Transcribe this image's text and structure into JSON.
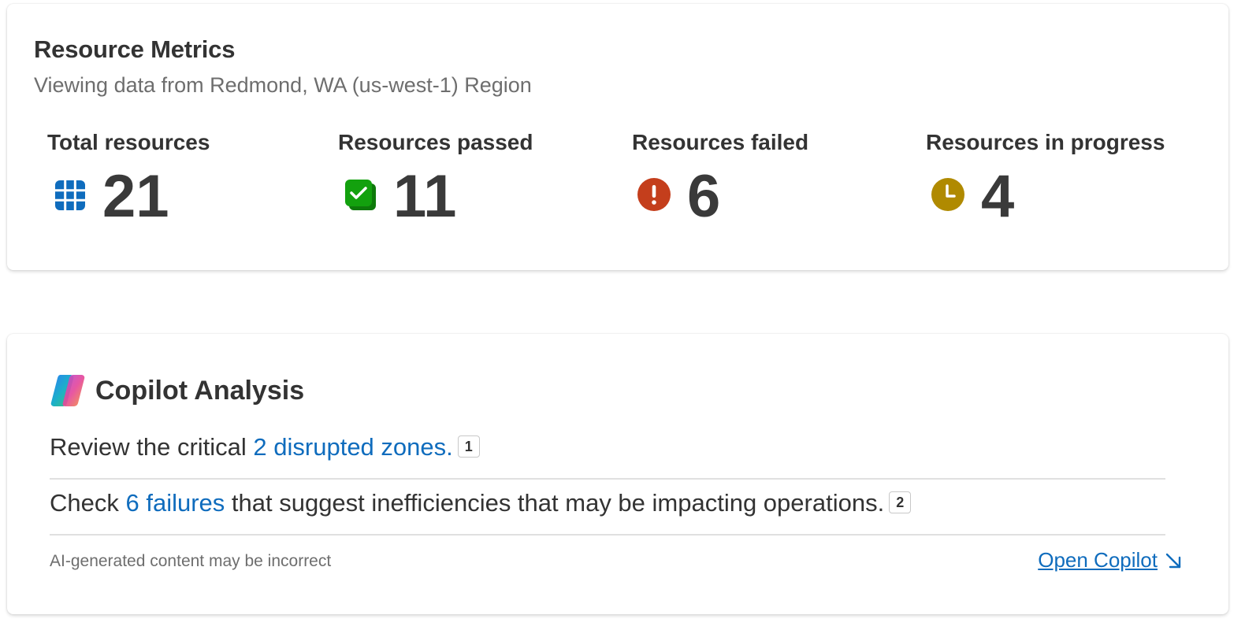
{
  "metrics": {
    "title": "Resource Metrics",
    "subtitle": "Viewing data from Redmond, WA (us-west-1) Region",
    "items": [
      {
        "label": "Total resources",
        "value": "21",
        "icon": "grid-icon",
        "color": "#0f6cbd"
      },
      {
        "label": "Resources passed",
        "value": "11",
        "icon": "checkbox-stack-icon",
        "color": "#13a10e"
      },
      {
        "label": "Resources failed",
        "value": "6",
        "icon": "error-circle-icon",
        "color": "#c43e1c"
      },
      {
        "label": "Resources in progress",
        "value": "4",
        "icon": "clock-icon",
        "color": "#b08a00"
      }
    ]
  },
  "copilot": {
    "title": "Copilot Analysis",
    "insights": [
      {
        "prefix": "Review the critical ",
        "link": "2 disrupted zones.",
        "suffix": "",
        "citation": "1"
      },
      {
        "prefix": "Check ",
        "link": "6 failures",
        "suffix": " that suggest inefficiencies that may be impacting operations.",
        "citation": "2"
      }
    ],
    "disclaimer": "AI-generated content may be incorrect",
    "open_label": "Open Copilot"
  },
  "colors": {
    "link": "#0f6cbd",
    "text": "#333333",
    "muted": "#6e6e6e"
  }
}
